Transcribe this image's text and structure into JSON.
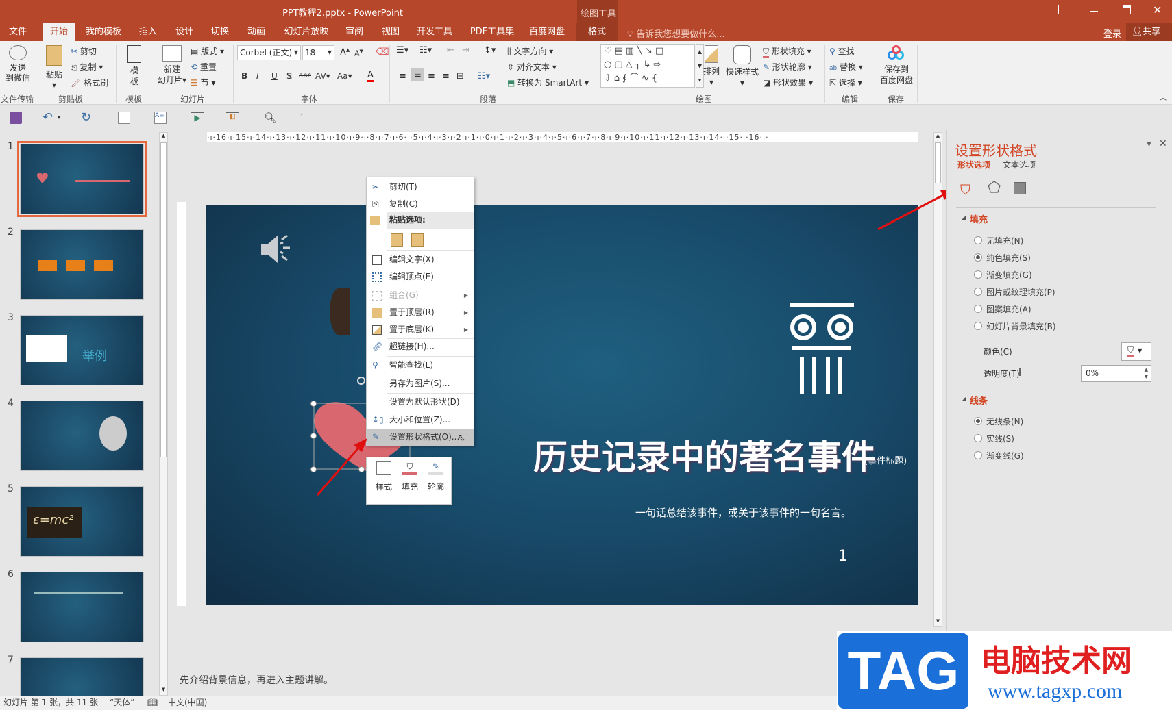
{
  "window": {
    "title": "PPT教程2.pptx - PowerPoint",
    "context_tab_group": "绘图工具",
    "tell_me": "告诉我您想要做什么...",
    "login": "登录",
    "share": "共享"
  },
  "tabs": [
    "文件",
    "开始",
    "我的模板",
    "插入",
    "设计",
    "切换",
    "动画",
    "幻灯片放映",
    "审阅",
    "视图",
    "开发工具",
    "PDF工具集",
    "百度网盘",
    "格式"
  ],
  "ribbon": {
    "wechat": {
      "label1": "发送",
      "label2": "到微信",
      "group": "文件传输"
    },
    "clipboard": {
      "paste": "粘贴",
      "cut": "剪切",
      "copy": "复制",
      "format_painter": "格式刷",
      "group": "剪贴板"
    },
    "template": {
      "label1": "模",
      "label2": "板",
      "group": "模板"
    },
    "slides": {
      "new1": "新建",
      "new2": "幻灯片",
      "layout": "版式",
      "reset": "重置",
      "section": "节",
      "group": "幻灯片"
    },
    "font": {
      "name": "Corbel (正文)",
      "size": "18",
      "bold": "B",
      "italic": "I",
      "underline": "U",
      "shadow": "S",
      "strike": "abc",
      "spacing": "AV",
      "case": "Aa",
      "color": "A",
      "group": "字体"
    },
    "paragraph": {
      "text_direction": "文字方向",
      "align_text": "对齐文本",
      "smartart": "转换为 SmartArt",
      "group": "段落"
    },
    "drawing": {
      "arrange": "排列",
      "quick_styles": "快速样式",
      "shape_fill": "形状填充",
      "shape_outline": "形状轮廓",
      "shape_effects": "形状效果",
      "group": "绘图"
    },
    "editing": {
      "find": "查找",
      "replace": "替换",
      "select": "选择",
      "group": "编辑"
    },
    "save": {
      "label1": "保存到",
      "label2": "百度网盘",
      "group": "保存"
    }
  },
  "ruler": "·ı·16·ı·15·ı·14·ı·13·ı·12·ı·11·ı·10·ı·9·ı·8·ı·7·ı·6·ı·5·ı·4·ı·3·ı·2·ı·1·ı·0·ı·1·ı·2·ı·3·ı·4·ı·5·ı·6·ı·7·ı·8·ı·9·ı·10·ı·11·ı·12·ı·13·ı·14·ı·15·ı·16·ı·",
  "thumbnails": [
    {
      "num": "1"
    },
    {
      "num": "2"
    },
    {
      "num": "3",
      "label": "举例"
    },
    {
      "num": "4"
    },
    {
      "num": "5",
      "label": "ε=mc²"
    },
    {
      "num": "6"
    },
    {
      "num": "7"
    }
  ],
  "slide": {
    "title": "历史记录中的著名事件",
    "title_note": "(事件标题)",
    "subtitle": "一句话总结该事件，或关于该事件的一句名言。",
    "page_number": "1"
  },
  "context_menu": {
    "items": [
      "剪切(T)",
      "复制(C)",
      "粘贴选项:",
      "编辑文字(X)",
      "编辑顶点(E)",
      "组合(G)",
      "置于顶层(R)",
      "置于底层(K)",
      "超链接(H)...",
      "智能查找(L)",
      "另存为图片(S)...",
      "设置为默认形状(D)",
      "大小和位置(Z)...",
      "设置形状格式(O)..."
    ]
  },
  "mini_toolbar": {
    "style": "样式",
    "fill": "填充",
    "outline": "轮廓"
  },
  "pane": {
    "title": "设置形状格式",
    "tab_shape": "形状选项",
    "tab_text": "文本选项",
    "fill_header": "填充",
    "fill_options": [
      "无填充(N)",
      "纯色填充(S)",
      "渐变填充(G)",
      "图片或纹理填充(P)",
      "图案填充(A)",
      "幻灯片背景填充(B)"
    ],
    "fill_selected": 1,
    "color_label": "颜色(C)",
    "transparency_label": "透明度(T)",
    "transparency_value": "0%",
    "line_header": "线条",
    "line_options": [
      "无线条(N)",
      "实线(S)",
      "渐变线(G)"
    ],
    "line_selected": 0
  },
  "notes": "先介绍背景信息，再进入主题讲解。",
  "status": {
    "slide_info": "幻灯片 第 1 张，共 11 张",
    "theme": "“天体”",
    "language": "中文(中国)"
  },
  "watermark": {
    "logo": "TAG",
    "site_name": "电脑技术网",
    "url": "www.tagxp.com"
  },
  "colors": {
    "accent": "#b7472a",
    "pane_accent": "#d24726",
    "heart": "#d9676f",
    "slide_bg": "#184a69"
  }
}
